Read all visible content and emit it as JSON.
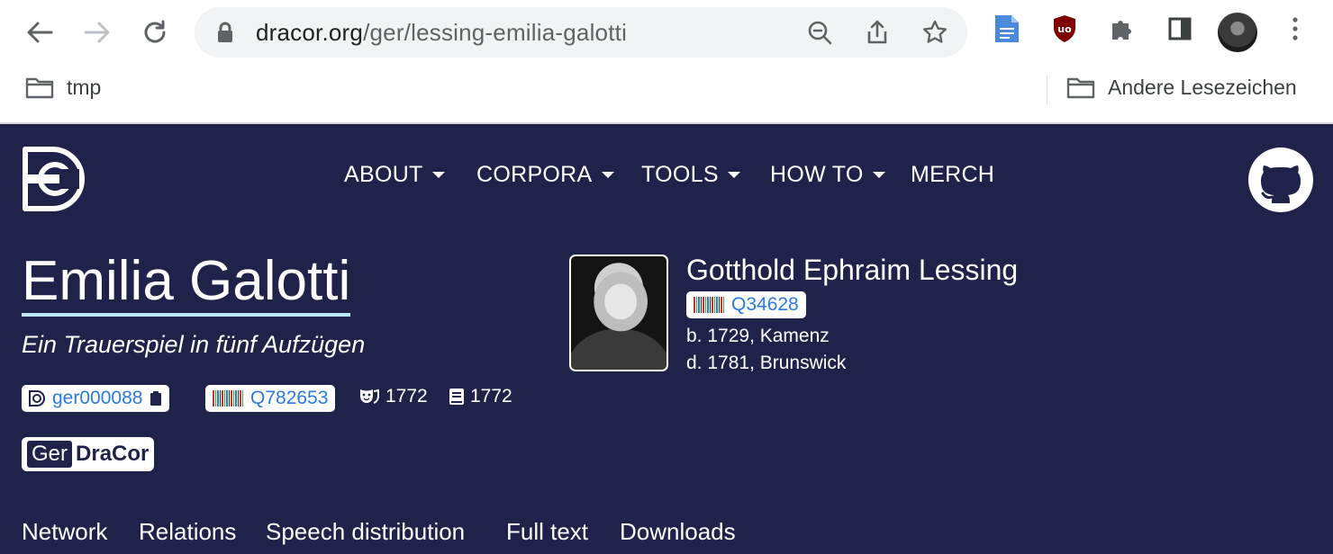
{
  "browser": {
    "url_host": "dracor.org",
    "url_path": "/ger/lessing-emilia-galotti",
    "bookmarks": {
      "left": "tmp",
      "right": "Andere Lesezeichen"
    }
  },
  "nav": {
    "menu": [
      {
        "label": "ABOUT",
        "dropdown": true
      },
      {
        "label": "CORPORA",
        "dropdown": true
      },
      {
        "label": "TOOLS",
        "dropdown": true
      },
      {
        "label": "HOW TO",
        "dropdown": true
      },
      {
        "label": "MERCH",
        "dropdown": false
      }
    ]
  },
  "play": {
    "title": "Emilia Galotti",
    "subtitle": "Ein Trauerspiel in fünf Aufzügen",
    "dracor_id": "ger000088",
    "wikidata_id": "Q782653",
    "premiere_year": "1772",
    "print_year": "1772",
    "corpus_prefix": "Ger",
    "corpus_name": "DraCor"
  },
  "author": {
    "name": "Gotthold Ephraim Lessing",
    "wikidata_id": "Q34628",
    "born": "b. 1729, Kamenz",
    "died": "d. 1781, Brunswick"
  },
  "tabs": [
    "Network",
    "Relations",
    "Speech distribution",
    "Full text",
    "Downloads"
  ],
  "colors": {
    "page_bg": "#1f2349",
    "link": "#2a7be4",
    "title_underline": "#bde7f7",
    "omnibox_bg": "#f1f3f4"
  }
}
